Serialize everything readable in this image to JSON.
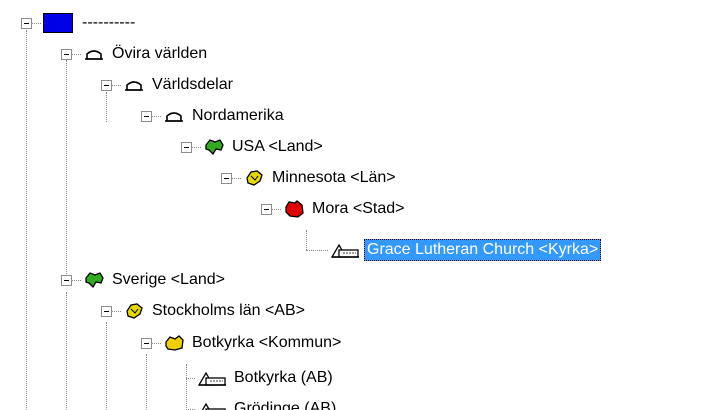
{
  "tree": {
    "root": {
      "label": "----------",
      "color": "#0000e6"
    },
    "nodes": [
      {
        "label": "Övira världen",
        "icon": "continent-cap-icon"
      },
      {
        "label": "Världsdelar",
        "icon": "continent-cap-icon"
      },
      {
        "label": "Nordamerika",
        "icon": "continent-cap-icon"
      },
      {
        "label": "USA <Land>",
        "icon": "country-map-icon",
        "color": "#33aa22"
      },
      {
        "label": "Minnesota <Län>",
        "icon": "county-map-icon",
        "color": "#e6d800"
      },
      {
        "label": "Mora <Stad>",
        "icon": "city-map-icon",
        "color": "#e00000"
      },
      {
        "label": "Grace Lutheran Church <Kyrka>",
        "icon": "church-icon",
        "selected": true
      },
      {
        "label": "Sverige <Land>",
        "icon": "country-map-icon",
        "color": "#33aa22"
      },
      {
        "label": "Stockholms län <AB>",
        "icon": "county-map-icon",
        "color": "#e6d800"
      },
      {
        "label": "Botkyrka <Kommun>",
        "icon": "municipality-map-icon",
        "color": "#f0d000"
      },
      {
        "label": "Botkyrka (AB)",
        "icon": "church-icon"
      },
      {
        "label": "Grödinge (AB)",
        "icon": "church-icon"
      }
    ]
  },
  "colors": {
    "selection": "#3399ff",
    "country": "#33aa22",
    "county": "#e6d800",
    "city": "#e00000"
  }
}
